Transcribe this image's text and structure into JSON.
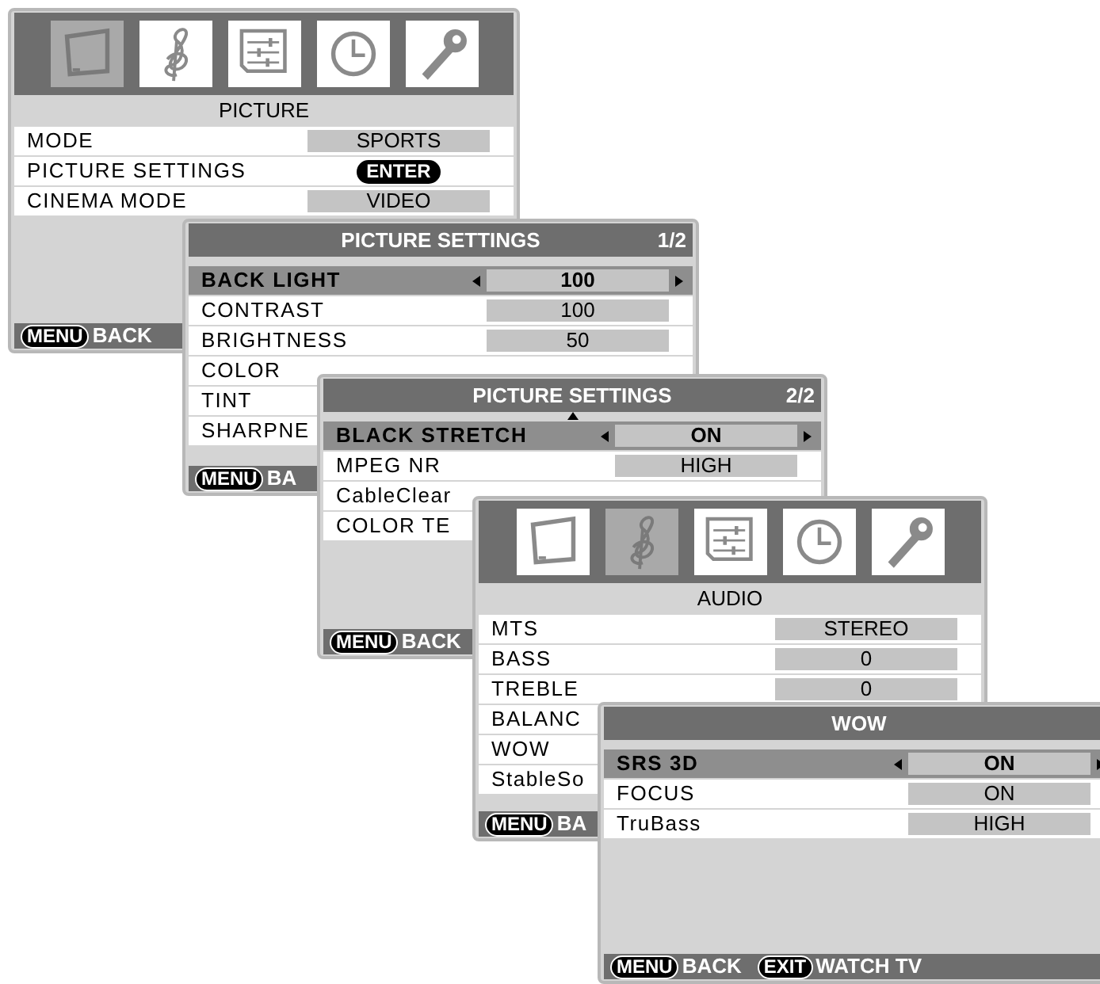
{
  "windows": [
    {
      "kind": "main",
      "icons": [
        {
          "selected": true
        },
        {
          "selected": false
        },
        {
          "selected": false
        },
        {
          "selected": false
        },
        {
          "selected": false
        }
      ],
      "title": "PICTURE",
      "rows": [
        {
          "label": "MODE",
          "value": "SPORTS",
          "kind": "box",
          "selected": false
        },
        {
          "label": "PICTURE SETTINGS",
          "value": "ENTER",
          "kind": "pill",
          "selected": false
        },
        {
          "label": "CINEMA MODE",
          "value": "VIDEO",
          "kind": "box",
          "selected": false
        }
      ],
      "footer": [
        {
          "key": "MENU",
          "label": "BACK"
        }
      ]
    },
    {
      "kind": "sub",
      "title": "PICTURE SETTINGS",
      "page": "1/2",
      "rows": [
        {
          "label": "BACK LIGHT",
          "value": "100",
          "kind": "box",
          "selected": true
        },
        {
          "label": "CONTRAST",
          "value": "100",
          "kind": "box",
          "selected": false
        },
        {
          "label": "BRIGHTNESS",
          "value": "50",
          "kind": "box",
          "selected": false
        },
        {
          "label": "COLOR",
          "selected": false
        },
        {
          "label": "TINT",
          "selected": false
        },
        {
          "label": "SHARPNE",
          "selected": false
        }
      ],
      "footer": [
        {
          "key": "MENU",
          "label": "BA"
        }
      ]
    },
    {
      "kind": "sub",
      "title": "PICTURE SETTINGS",
      "page": "2/2",
      "more_above": true,
      "rows": [
        {
          "label": "BLACK STRETCH",
          "value": "ON",
          "kind": "box",
          "selected": true
        },
        {
          "label": "MPEG NR",
          "value": "HIGH",
          "kind": "box",
          "selected": false
        },
        {
          "label": "CableClear",
          "selected": false
        },
        {
          "label": "COLOR TE",
          "selected": false
        }
      ],
      "footer": [
        {
          "key": "MENU",
          "label": "BACK"
        }
      ]
    },
    {
      "kind": "main",
      "icons": [
        {
          "selected": false
        },
        {
          "selected": true
        },
        {
          "selected": false
        },
        {
          "selected": false
        },
        {
          "selected": false
        }
      ],
      "title": "AUDIO",
      "rows": [
        {
          "label": "MTS",
          "value": "STEREO",
          "kind": "box",
          "selected": false
        },
        {
          "label": "BASS",
          "value": "0",
          "kind": "box",
          "selected": false
        },
        {
          "label": "TREBLE",
          "value": "0",
          "kind": "box",
          "selected": false
        },
        {
          "label": "BALANC",
          "selected": false
        },
        {
          "label": "WOW",
          "selected": false
        },
        {
          "label": "StableSo",
          "selected": false
        }
      ],
      "footer": [
        {
          "key": "MENU",
          "label": "BA"
        }
      ]
    },
    {
      "kind": "sub",
      "title": "WOW",
      "rows": [
        {
          "label": "SRS 3D",
          "value": "ON",
          "kind": "box",
          "selected": true
        },
        {
          "label": "FOCUS",
          "value": "ON",
          "kind": "box",
          "selected": false
        },
        {
          "label": "TruBass",
          "value": "HIGH",
          "kind": "box",
          "selected": false
        }
      ],
      "footer": [
        {
          "key": "MENU",
          "label": "BACK"
        },
        {
          "key": "EXIT",
          "label": "WATCH TV"
        }
      ]
    }
  ]
}
